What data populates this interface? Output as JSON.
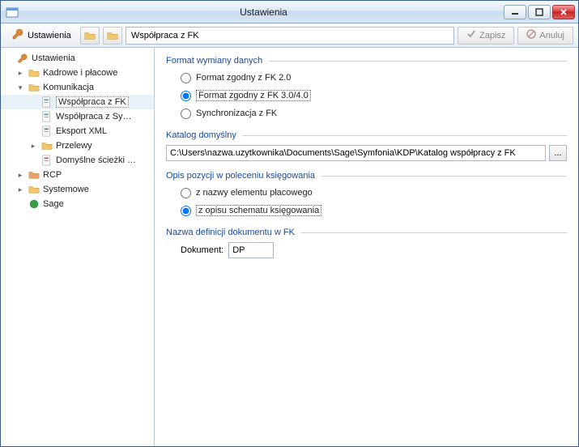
{
  "window": {
    "title": "Ustawienia"
  },
  "toolbar": {
    "label": "Ustawienia",
    "path_value": "Współpraca z FK",
    "save_label": "Zapisz",
    "cancel_label": "Anuluj"
  },
  "tree": {
    "root": "Ustawienia",
    "items": [
      {
        "label": "Kadrowe i płacowe",
        "expandable": true,
        "expanded": false,
        "depth": 1,
        "icon": "folder"
      },
      {
        "label": "Komunikacja",
        "expandable": true,
        "expanded": true,
        "depth": 1,
        "icon": "folder"
      },
      {
        "label": "Współpraca z FK",
        "depth": 2,
        "icon": "doc-green",
        "selected": true
      },
      {
        "label": "Współpraca z Sy…",
        "depth": 2,
        "icon": "doc-green"
      },
      {
        "label": "Eksport XML",
        "depth": 2,
        "icon": "doc-blue"
      },
      {
        "label": "Przelewy",
        "expandable": true,
        "expanded": false,
        "depth": 2,
        "icon": "folder"
      },
      {
        "label": "Domyślne ścieżki …",
        "depth": 2,
        "icon": "doc-red"
      },
      {
        "label": "RCP",
        "expandable": true,
        "expanded": false,
        "depth": 1,
        "icon": "folder-red"
      },
      {
        "label": "Systemowe",
        "expandable": true,
        "expanded": false,
        "depth": 1,
        "icon": "folder"
      },
      {
        "label": "Sage",
        "depth": 1,
        "icon": "sage"
      }
    ]
  },
  "groups": {
    "format": {
      "title": "Format wymiany danych",
      "options": [
        {
          "label": "Format zgodny z FK 2.0",
          "checked": false
        },
        {
          "label": "Format zgodny z FK 3.0/4.0",
          "checked": true
        },
        {
          "label": "Synchronizacja z FK",
          "checked": false
        }
      ]
    },
    "katalog": {
      "title": "Katalog domyślny",
      "path": "C:\\Users\\nazwa.uzytkownika\\Documents\\Sage\\Symfonia\\KDP\\Katalog współpracy z FK",
      "browse": "..."
    },
    "opis": {
      "title": "Opis pozycji w poleceniu księgowania",
      "options": [
        {
          "label": "z nazwy elementu płacowego",
          "checked": false
        },
        {
          "label": "z opisu schematu księgowania",
          "checked": true
        }
      ]
    },
    "dokument": {
      "title": "Nazwa definicji dokumentu w FK",
      "label": "Dokument:",
      "value": "DP"
    }
  }
}
